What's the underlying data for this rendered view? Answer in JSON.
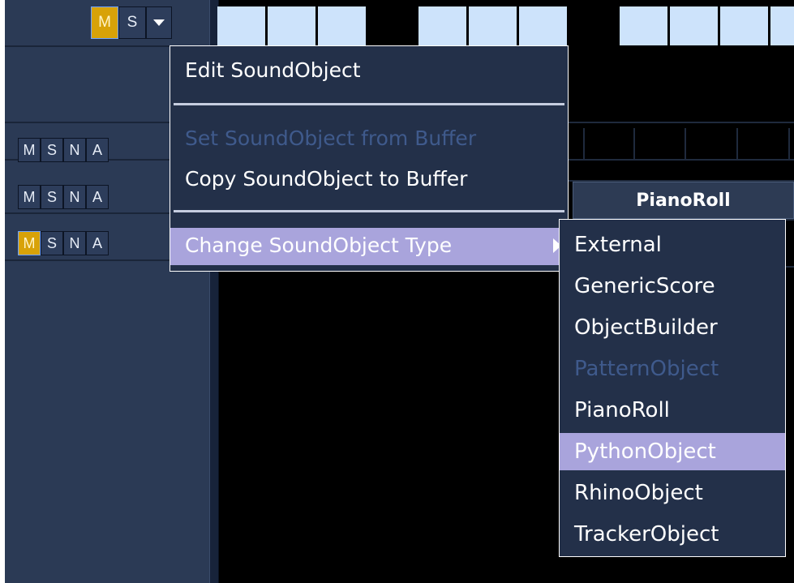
{
  "track_buttons": {
    "top": {
      "mute": "M",
      "solo": "S",
      "dropdown_icon": "triangle-down-icon"
    },
    "rows": [
      {
        "m": "M",
        "s": "S",
        "n": "N",
        "a": "A",
        "mute_active": false
      },
      {
        "m": "M",
        "s": "S",
        "n": "N",
        "a": "A",
        "mute_active": false
      },
      {
        "m": "M",
        "s": "S",
        "n": "N",
        "a": "A",
        "mute_active": true
      }
    ]
  },
  "timeline": {
    "soundobject_label": "PianoRoll"
  },
  "colors": {
    "panel": "#2b3a55",
    "menu_bg": "#233049",
    "highlight": "#a9a4dc",
    "mute_active": "#d8a208",
    "disabled_text": "#3f5a8c",
    "ruler_light": "#cde3fb"
  },
  "popup_menu": {
    "edit": "Edit SoundObject",
    "set_from_buffer": "Set SoundObject from Buffer",
    "copy_to_buffer": "Copy SoundObject to Buffer",
    "change_type": "Change SoundObject Type"
  },
  "type_submenu": {
    "items": [
      {
        "label": "External",
        "disabled": false,
        "highlighted": false
      },
      {
        "label": "GenericScore",
        "disabled": false,
        "highlighted": false
      },
      {
        "label": "ObjectBuilder",
        "disabled": false,
        "highlighted": false
      },
      {
        "label": "PatternObject",
        "disabled": true,
        "highlighted": false
      },
      {
        "label": "PianoRoll",
        "disabled": false,
        "highlighted": false
      },
      {
        "label": "PythonObject",
        "disabled": false,
        "highlighted": true
      },
      {
        "label": "RhinoObject",
        "disabled": false,
        "highlighted": false
      },
      {
        "label": "TrackerObject",
        "disabled": false,
        "highlighted": false
      }
    ]
  }
}
